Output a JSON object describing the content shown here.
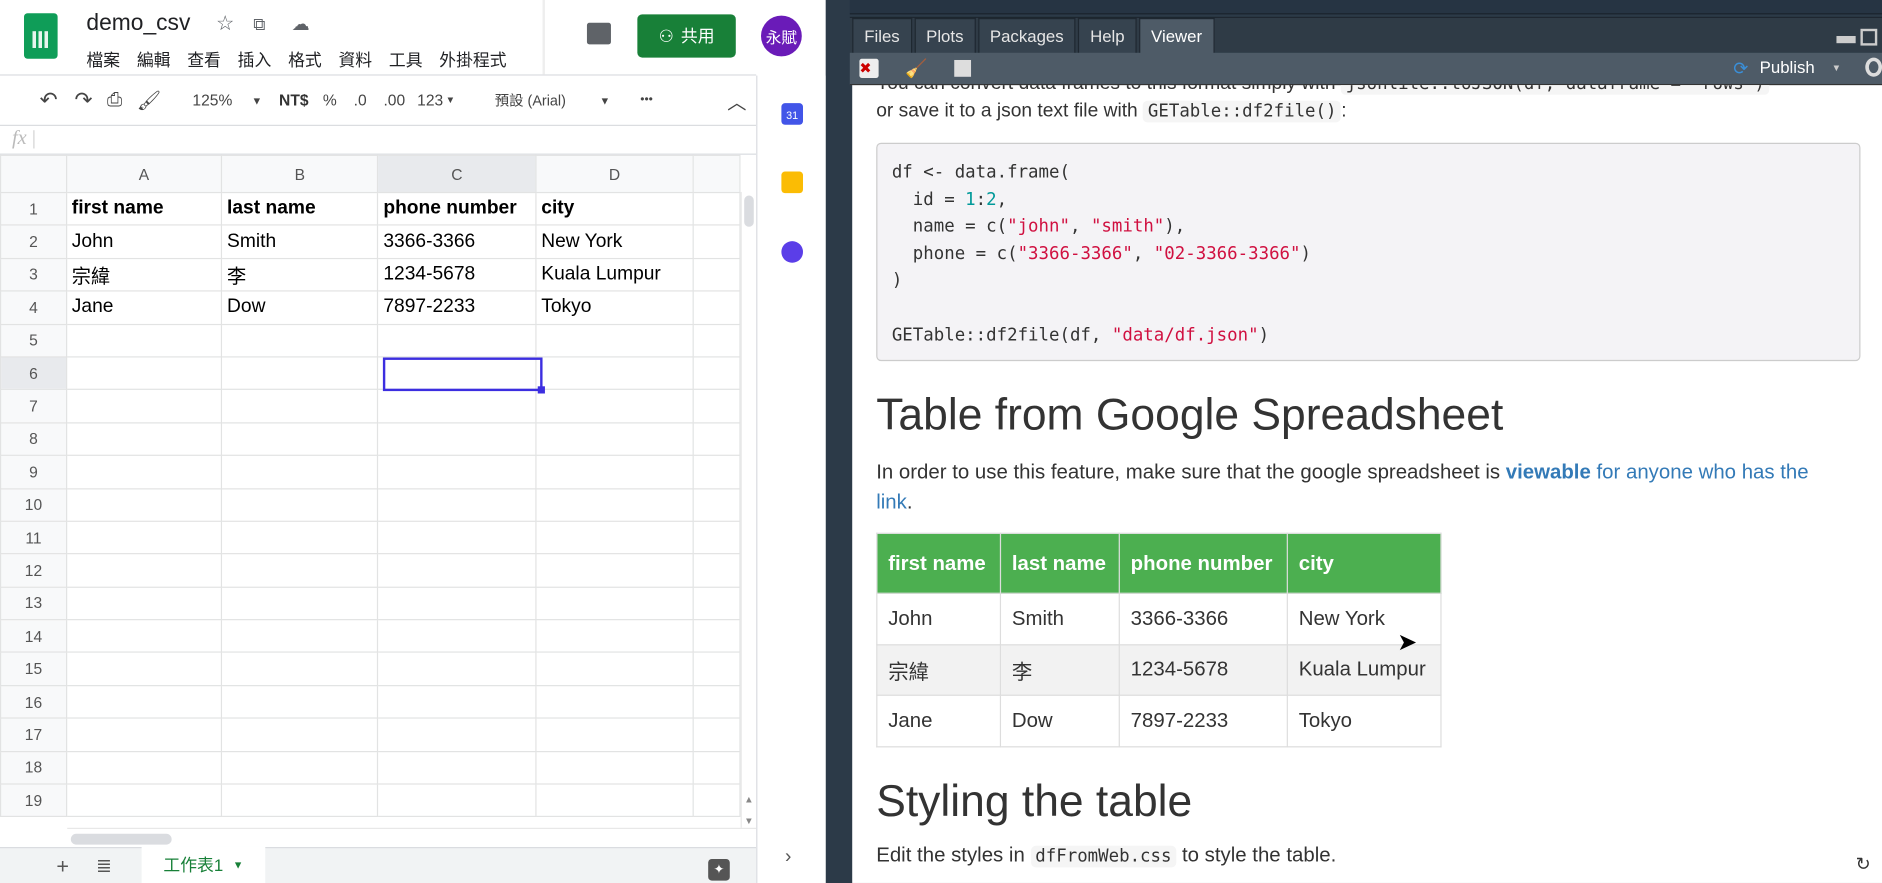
{
  "sheets": {
    "title": "demo_csv",
    "menu": [
      "檔案",
      "編輯",
      "查看",
      "插入",
      "格式",
      "資料",
      "工具",
      "外掛程式"
    ],
    "share_label": "共用",
    "avatar_text": "永賦",
    "toolbar": {
      "zoom": "125%",
      "currency": "NT$",
      "percent": "%",
      "dec_less": ".0",
      "dec_more": ".00",
      "format": "123",
      "font": "預設 (Arial)",
      "more": "•••"
    },
    "fx_label": "fx",
    "columns": [
      "A",
      "B",
      "C",
      "D",
      ""
    ],
    "rows": [
      [
        "first name",
        "last name",
        "phone number",
        "city"
      ],
      [
        "John",
        "Smith",
        "3366-3366",
        "New York"
      ],
      [
        "宗緯",
        "李",
        "1234-5678",
        "Kuala Lumpur"
      ],
      [
        "Jane",
        "Dow",
        "7897-2233",
        "Tokyo"
      ]
    ],
    "row_numbers": [
      "1",
      "2",
      "3",
      "4",
      "5",
      "6",
      "7",
      "8",
      "9",
      "10",
      "11",
      "12",
      "13",
      "14",
      "15",
      "16",
      "17",
      "18",
      "19"
    ],
    "selected_cell": "C6",
    "sheet_tab": "工作表1",
    "accent": "#188038"
  },
  "rstudio": {
    "tabs": [
      "Files",
      "Plots",
      "Packages",
      "Help",
      "Viewer"
    ],
    "active_tab": "Viewer",
    "publish_label": "Publish",
    "top_line_text": "You can convert data frames to this format simply with",
    "top_line_code": "jsonlite::toJSON(df, dataframe = \"rows\")",
    "save_text": "or save it to a json text file with",
    "save_code": "GETable::df2file()",
    "save_end": ":",
    "code": {
      "l1": "df <- data.frame(",
      "l2a": "  id = ",
      "l2n1": "1",
      "l2c": ":",
      "l2n2": "2",
      "l2e": ",",
      "l3a": "  name = c(",
      "l3s1": "\"john\"",
      "l3c": ", ",
      "l3s2": "\"smith\"",
      "l3e": "),",
      "l4a": "  phone = c(",
      "l4s1": "\"3366-3366\"",
      "l4c": ", ",
      "l4s2": "\"02-3366-3366\"",
      "l4e": ")",
      "l5": ")",
      "l7a": "GETable::df2file(df, ",
      "l7s": "\"data/df.json\"",
      "l7e": ")"
    },
    "h_table": "Table from Google Spreadsheet",
    "p1a": "In order to use this feature, make sure that the google spreadsheet is ",
    "p1b": "viewable",
    "p1c": " for anyone who has the link",
    "p1d": ".",
    "table_headers": [
      "first name",
      "last name",
      "phone number",
      "city"
    ],
    "table_rows": [
      [
        "John",
        "Smith",
        "3366-3366",
        "New York"
      ],
      [
        "宗緯",
        "李",
        "1234-5678",
        "Kuala Lumpur"
      ],
      [
        "Jane",
        "Dow",
        "7897-2233",
        "Tokyo"
      ]
    ],
    "h_style": "Styling the table",
    "p2a": "Edit the styles in ",
    "p2code": "dfFromWeb.css",
    "p2b": " to style the table.",
    "table_header_color": "#4caf50"
  }
}
